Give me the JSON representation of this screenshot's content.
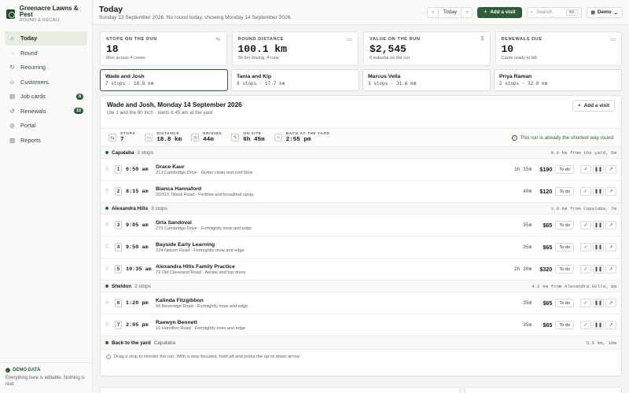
{
  "brand": {
    "name": "Greenacre Lawns & Pest",
    "subtitle": "ROUND & RECALL"
  },
  "nav": [
    {
      "label": "Today",
      "icon": "home-icon",
      "active": true,
      "badge": ""
    },
    {
      "label": "Round",
      "icon": "round-icon",
      "badge": ""
    },
    {
      "label": "Recurring",
      "icon": "recurring-icon",
      "badge": ""
    },
    {
      "label": "Customers",
      "icon": "customers-icon",
      "badge": ""
    },
    {
      "label": "Job cards",
      "icon": "job-cards-icon",
      "badge": "8"
    },
    {
      "label": "Renewals",
      "icon": "renewals-icon",
      "badge": "10"
    },
    {
      "label": "Portal",
      "icon": "portal-icon",
      "badge": ""
    },
    {
      "label": "Reports",
      "icon": "reports-icon",
      "badge": ""
    }
  ],
  "demo": {
    "title": "DEMO DATA",
    "text": "Everything here is editable. Nothing is real."
  },
  "header": {
    "title": "Today",
    "subtitle": "Sunday 13 September 2026. No round today, showing Monday 14 September 2026.",
    "today_label": "Today",
    "add_visit": "Add a visit",
    "search_placeholder": "Search",
    "search_kbd": "⌘K",
    "demo_select": "Demo"
  },
  "stats": [
    {
      "label": "STOPS ON THE RUN",
      "value": "18",
      "sub": "Mon across 4 crews",
      "icon": "route-icon"
    },
    {
      "label": "ROUND DISTANCE",
      "value": "100.1 km",
      "sub": "3h 6m driving, 4 runs",
      "icon": "truck-icon"
    },
    {
      "label": "VALUE ON THE RUN",
      "value": "$2,545",
      "sub": "6 suburbs on the run",
      "icon": "dollar-icon"
    },
    {
      "label": "RENEWALS DUE",
      "value": "10",
      "sub": "Cards ready to bill",
      "icon": "card-icon"
    }
  ],
  "crews": [
    {
      "name": "Wade and Josh",
      "meta": "7 stops · 18.8 km"
    },
    {
      "name": "Tania and Kip",
      "meta": "6 stops · 17.7 km"
    },
    {
      "name": "Marcus Vella",
      "meta": "3 stops · 31.6 km"
    },
    {
      "name": "Priya Raman",
      "meta": "2 stops · 32.0 km"
    }
  ],
  "run": {
    "title": "Wade and Josh, Monday 14 September 2026",
    "subtitle": "Ute 1 and the 60 inch · starts 6:45 am at the yard",
    "add_visit": "Add a visit",
    "metrics": [
      {
        "label": "STOPS",
        "value": "7"
      },
      {
        "label": "DISTANCE",
        "value": "18.8 km"
      },
      {
        "label": "DRIVING",
        "value": "44m"
      },
      {
        "label": "ON SITE",
        "value": "6h 45m"
      },
      {
        "label": "BACK AT THE YARD",
        "value": "2:55 pm"
      }
    ],
    "shortest": "This run is already the shortest way round",
    "groups": [
      {
        "name": "Capalaba",
        "count": "2 stops",
        "dist": "0.9 km from the yard, 5m",
        "stops": [
          {
            "n": "1",
            "time": "6:50 am",
            "name": "Grace Kaur",
            "addr": "213 Cambridge Drive · Gutter clean and roof blow",
            "dur": "1h 15m",
            "price": "$190",
            "status": "To do"
          },
          {
            "n": "2",
            "time": "8:15 am",
            "name": "Bianca Hannaford",
            "addr": "20/310 Tillack Road · Fertilise and broadleaf spray",
            "dur": "40m",
            "price": "$120",
            "status": "To do"
          }
        ]
      },
      {
        "name": "Alexandra Hills",
        "count": "3 stops",
        "dist": "3.8 km from Capalaba, 7m",
        "stops": [
          {
            "n": "3",
            "time": "9:05 am",
            "name": "Orla Sandoval",
            "addr": "273 Cambridge Drive · Fortnightly mow and edge",
            "dur": "35m",
            "price": "$65",
            "status": "To do"
          },
          {
            "n": "4",
            "time": "9:50 am",
            "name": "Bayside Early Learning",
            "addr": "224 Nelson Road · Fortnightly mow and edge",
            "dur": "35m",
            "price": "$65",
            "status": "To do"
          },
          {
            "n": "5",
            "time": "10:35 am",
            "name": "Alexandra Hills Family Practice",
            "addr": "72 Old Cleveland Road · Aerate and top dress",
            "dur": "2h 30m",
            "price": "$320",
            "status": "To do"
          }
        ]
      },
      {
        "name": "Sheldon",
        "count": "2 stops",
        "dist": "4.2 km from Alexandra Hills, 8m",
        "stops": [
          {
            "n": "6",
            "time": "1:20 pm",
            "name": "Kalinda Fitzgibbon",
            "addr": "66 Beveridge Road · Fortnightly mow and edge",
            "dur": "35m",
            "price": "$65",
            "status": "To do"
          },
          {
            "n": "7",
            "time": "2:05 pm",
            "name": "Raewyn Bennett",
            "addr": "10 Hamilton Road · Fortnightly mow and edge",
            "dur": "35m",
            "price": "$65",
            "status": "To do"
          }
        ]
      }
    ],
    "back": {
      "title": "Back to the yard",
      "place": "Capalaba",
      "dist": "5.5 km, 10m"
    },
    "hint": "Drag a stop to reorder the run. With a stop focused, hold alt and press the up or down arrow."
  }
}
